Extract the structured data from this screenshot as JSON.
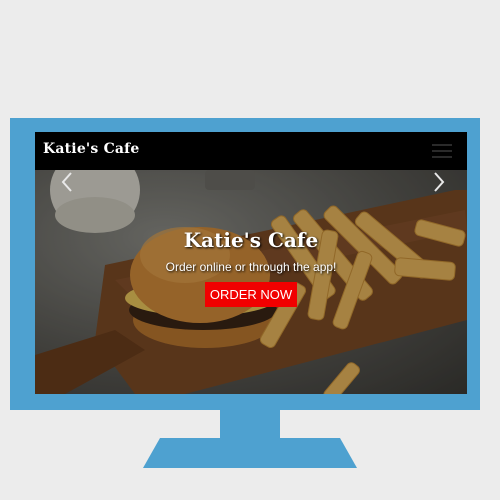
{
  "navbar": {
    "brand": "Katie's Cafe",
    "menu_icon": "hamburger-menu-icon"
  },
  "hero": {
    "title": "Katie's Cafe",
    "subtitle": "Order online or through the app!",
    "cta_label": "ORDER NOW",
    "prev_icon": "chevron-left-icon",
    "next_icon": "chevron-right-icon"
  },
  "colors": {
    "frame": "#4ea1d0",
    "cta": "#f10000",
    "navbar": "#000000"
  }
}
